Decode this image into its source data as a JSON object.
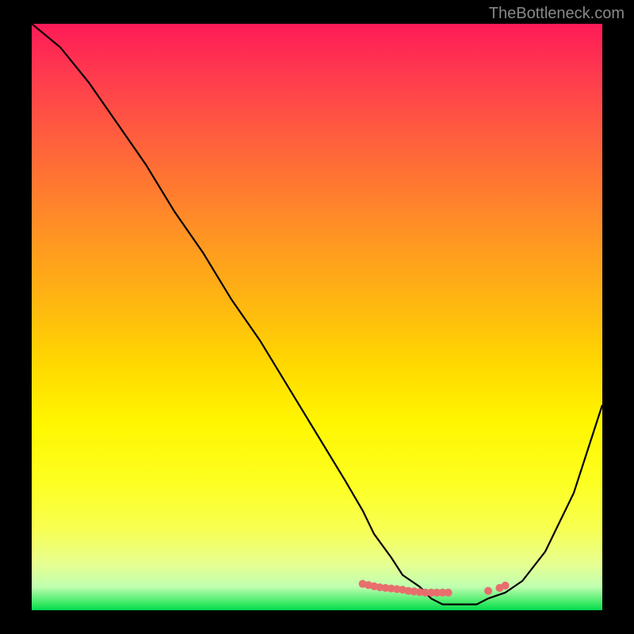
{
  "watermark": "TheBottleneck.com",
  "chart_data": {
    "type": "line",
    "title": "",
    "xlabel": "",
    "ylabel": "",
    "x_range": [
      0,
      100
    ],
    "y_range": [
      0,
      100
    ],
    "series": [
      {
        "name": "bottleneck-curve",
        "color": "#000000",
        "x": [
          0,
          5,
          10,
          15,
          20,
          25,
          30,
          35,
          40,
          45,
          50,
          55,
          58,
          60,
          63,
          65,
          68,
          70,
          72,
          75,
          78,
          80,
          83,
          86,
          90,
          95,
          100
        ],
        "y": [
          100,
          96,
          90,
          83,
          76,
          68,
          61,
          53,
          46,
          38,
          30,
          22,
          17,
          13,
          9,
          6,
          4,
          2,
          1,
          1,
          1,
          2,
          3,
          5,
          10,
          20,
          35
        ]
      }
    ],
    "markers": {
      "name": "highlight-dots",
      "color": "#e86e6e",
      "x": [
        58,
        59,
        60,
        61,
        62,
        63,
        64,
        65,
        66,
        67,
        68,
        69,
        70,
        71,
        72,
        73,
        80,
        82,
        83
      ],
      "y": [
        4.5,
        4.3,
        4.1,
        3.9,
        3.8,
        3.7,
        3.6,
        3.5,
        3.3,
        3.2,
        3.1,
        3.0,
        3.0,
        3.0,
        3.0,
        3.0,
        3.3,
        3.8,
        4.2
      ]
    },
    "gradient_colors": {
      "top": "#ff1a56",
      "mid_upper": "#ff9a20",
      "mid": "#fff600",
      "mid_lower": "#f8ff50",
      "bottom": "#00d850"
    }
  }
}
